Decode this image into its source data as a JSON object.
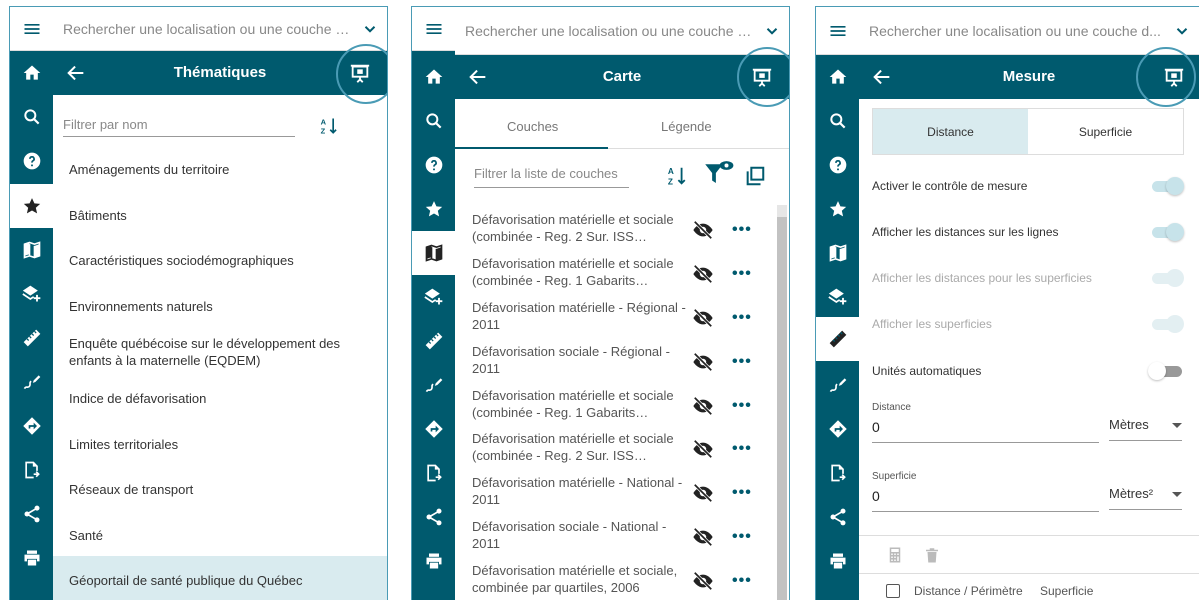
{
  "colors": {
    "brand": "#005a6e",
    "highlight": "#4a9bb5",
    "selected": "#d9ebef"
  },
  "search_placeholder": "Rechercher une localisation ou une couche d...",
  "rail_icons": [
    "menu-icon",
    "home-icon",
    "search-icon",
    "help-icon",
    "star-icon",
    "map-icon",
    "layers-add-icon",
    "ruler-icon",
    "draw-icon",
    "directions-icon",
    "export-icon",
    "share-icon",
    "print-icon"
  ],
  "panel1": {
    "title": "Thématiques",
    "filter_placeholder": "Filtrer par nom",
    "sort_label": "AZ",
    "items": [
      "Aménagements du territoire",
      "Bâtiments",
      "Caractéristiques sociodémographiques",
      "Environnements naturels",
      "Enquête québécoise sur le développement des enfants à la maternelle (EQDEM)",
      "Indice de défavorisation",
      "Limites territoriales",
      "Réseaux de transport",
      "Santé",
      "Géoportail de santé publique du Québec"
    ]
  },
  "panel2": {
    "title": "Carte",
    "tabs": [
      "Couches",
      "Légende"
    ],
    "filter_placeholder": "Filtrer la liste de couches",
    "layers": [
      "Défavorisation matérielle et sociale (combinée - Reg. 2 Sur. ISS…",
      "Défavorisation matérielle et sociale (combinée - Reg. 1 Gabarits…",
      "Défavorisation matérielle - Régional - 2011",
      "Défavorisation sociale - Régional - 2011",
      "Défavorisation matérielle et sociale (combinée - Reg. 1 Gabarits…",
      "Défavorisation matérielle et sociale (combinée - Reg. 2 Sur. ISS…",
      "Défavorisation matérielle - National - 2011",
      "Défavorisation sociale - National - 2011",
      "Défavorisation matérielle et sociale, combinée par quartiles, 2006"
    ],
    "more_label": "•••"
  },
  "panel3": {
    "title": "Mesure",
    "segments": [
      "Distance",
      "Superficie"
    ],
    "options": [
      "Activer le contrôle de mesure",
      "Afficher les distances sur les lignes",
      "Afficher les distances pour les superficies",
      "Afficher les superficies",
      "Unités automatiques"
    ],
    "distance_label": "Distance",
    "distance_value": "0",
    "distance_unit": "Mètres",
    "area_label": "Superficie",
    "area_value": "0",
    "area_unit": "Mètres²",
    "table_headers": [
      "Distance / Périmètre",
      "Superficie"
    ]
  }
}
